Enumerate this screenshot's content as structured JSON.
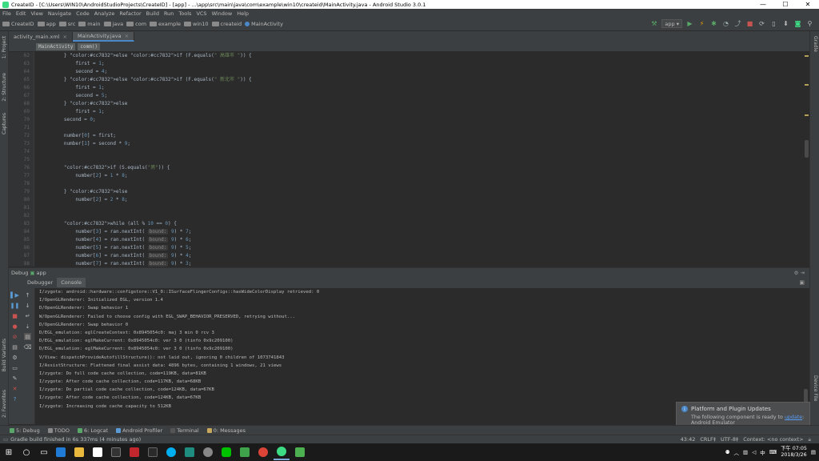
{
  "window": {
    "title": "CreateID - [C:\\Users\\WIN10\\AndroidStudioProjects\\CreateID] - [app] - ...\\app\\src\\main\\java\\com\\example\\win10\\createid\\MainActivity.java - Android Studio 3.0.1",
    "minimize": "—",
    "maximize": "☐",
    "close": "✕"
  },
  "menu": [
    "File",
    "Edit",
    "View",
    "Navigate",
    "Code",
    "Analyze",
    "Refactor",
    "Build",
    "Run",
    "Tools",
    "VCS",
    "Window",
    "Help"
  ],
  "breadcrumb": [
    "CreateID",
    "app",
    "src",
    "main",
    "java",
    "com",
    "example",
    "win10",
    "createid",
    "MainActivity"
  ],
  "run_config": "app",
  "editor_tabs": [
    {
      "label": "activity_main.xml",
      "active": false
    },
    {
      "label": "MainActivity.java",
      "active": true
    }
  ],
  "file_breadcrumb": [
    "MainActivity",
    "comm()"
  ],
  "left_tabs": {
    "project": "1: Project",
    "structure": "2: Structure",
    "captures": "Captures",
    "build_variants": "Build Variants",
    "favorites": "2: Favorites"
  },
  "right_tabs": {
    "gradle": "Gradle",
    "device_file": "Device File"
  },
  "code_lines": [
    {
      "n": "62",
      "text": "        } else if (F.equals(\" 高雄市 \")) {"
    },
    {
      "n": "63",
      "text": "            first = 1;"
    },
    {
      "n": "64",
      "text": "            second = 4;"
    },
    {
      "n": "65",
      "text": "        } else if (F.equals(\" 新北市 \")) {"
    },
    {
      "n": "66",
      "text": "            first = 1;"
    },
    {
      "n": "67",
      "text": "            second = 5;"
    },
    {
      "n": "68",
      "text": "        } else"
    },
    {
      "n": "69",
      "text": "            first = 1;"
    },
    {
      "n": "70",
      "text": "        second = 0;"
    },
    {
      "n": "71",
      "text": ""
    },
    {
      "n": "72",
      "text": "        number[0] = first;"
    },
    {
      "n": "73",
      "text": "        number[1] = second * 9;"
    },
    {
      "n": "74",
      "text": ""
    },
    {
      "n": "75",
      "text": ""
    },
    {
      "n": "76",
      "text": "        if (S.equals(\"男\")) {"
    },
    {
      "n": "77",
      "text": "            number[2] = 1 * 8;"
    },
    {
      "n": "78",
      "text": ""
    },
    {
      "n": "79",
      "text": "        } else"
    },
    {
      "n": "80",
      "text": "            number[2] = 2 * 8;"
    },
    {
      "n": "81",
      "text": ""
    },
    {
      "n": "82",
      "text": ""
    },
    {
      "n": "83",
      "text": "        while (all % 10 == 0) {"
    },
    {
      "n": "84",
      "text": "            number[3] = ran.nextInt( bound: 9) * 7;"
    },
    {
      "n": "85",
      "text": "            number[4] = ran.nextInt( bound: 9) * 6;"
    },
    {
      "n": "86",
      "text": "            number[5] = ran.nextInt( bound: 9) * 5;"
    },
    {
      "n": "87",
      "text": "            number[6] = ran.nextInt( bound: 9) * 4;"
    },
    {
      "n": "88",
      "text": "            number[7] = ran.nextInt( bound: 9) * 3;"
    }
  ],
  "debug": {
    "title": "Debug",
    "config": "app",
    "tabs": [
      "Debugger",
      "Console"
    ]
  },
  "console_lines": [
    "I/zygote: android::hardware::configstore::V1_0::ISurfaceFlingerConfigs::hasWideColorDisplay retrieved: 0",
    "I/OpenGLRenderer: Initialized EGL, version 1.4",
    "D/OpenGLRenderer: Swap behavior 1",
    "W/OpenGLRenderer: Failed to choose config with EGL_SWAP_BEHAVIOR_PRESERVED, retrying without...",
    "D/OpenGLRenderer: Swap behavior 0",
    "D/EGL_emulation: eglCreateContext: 0x8945054c0: maj 3 min 0 rcv 3",
    "D/EGL_emulation: eglMakeCurrent: 0x8945054c0: ver 3 0 (tinfo 0x9c209100)",
    "D/EGL_emulation: eglMakeCurrent: 0x8945054c0: ver 3 0 (tinfo 0x9c209100)",
    "V/View: dispatchProvideAutofillStructure(): not laid out, ignoring 0 children of 1073741843",
    "I/AssistStructure: Flattened final assist data: 4896 bytes, containing 1 windows, 21 views",
    "I/zygote: Do full code cache collection, code=119KB, data=81KB",
    "I/zygote: After code cache collection, code=117KB, data=68KB",
    "I/zygote: Do partial code cache collection, code=124KB, data=67KB",
    "I/zygote: After code cache collection, code=124KB, data=67KB",
    "I/zygote: Increasing code cache capacity to 512KB"
  ],
  "bottom_tabs": [
    "5: Debug",
    "TODO",
    "6: Logcat",
    "Android Profiler",
    "Terminal",
    "0: Messages"
  ],
  "status": {
    "message": "Gradle build finished in 6s 337ms (4 minutes ago)",
    "position": "43:42",
    "line_sep": "CRLF‡",
    "encoding": "UTF-8‡",
    "context": "Context: <no context>"
  },
  "notification": {
    "title": "Platform and Plugin Updates",
    "body": "The following component is ready to",
    "link": "update",
    "item": "Android Emulator"
  },
  "taskbar": {
    "ime": "中",
    "time": "下午 07:05",
    "date": "2018/3/26"
  }
}
